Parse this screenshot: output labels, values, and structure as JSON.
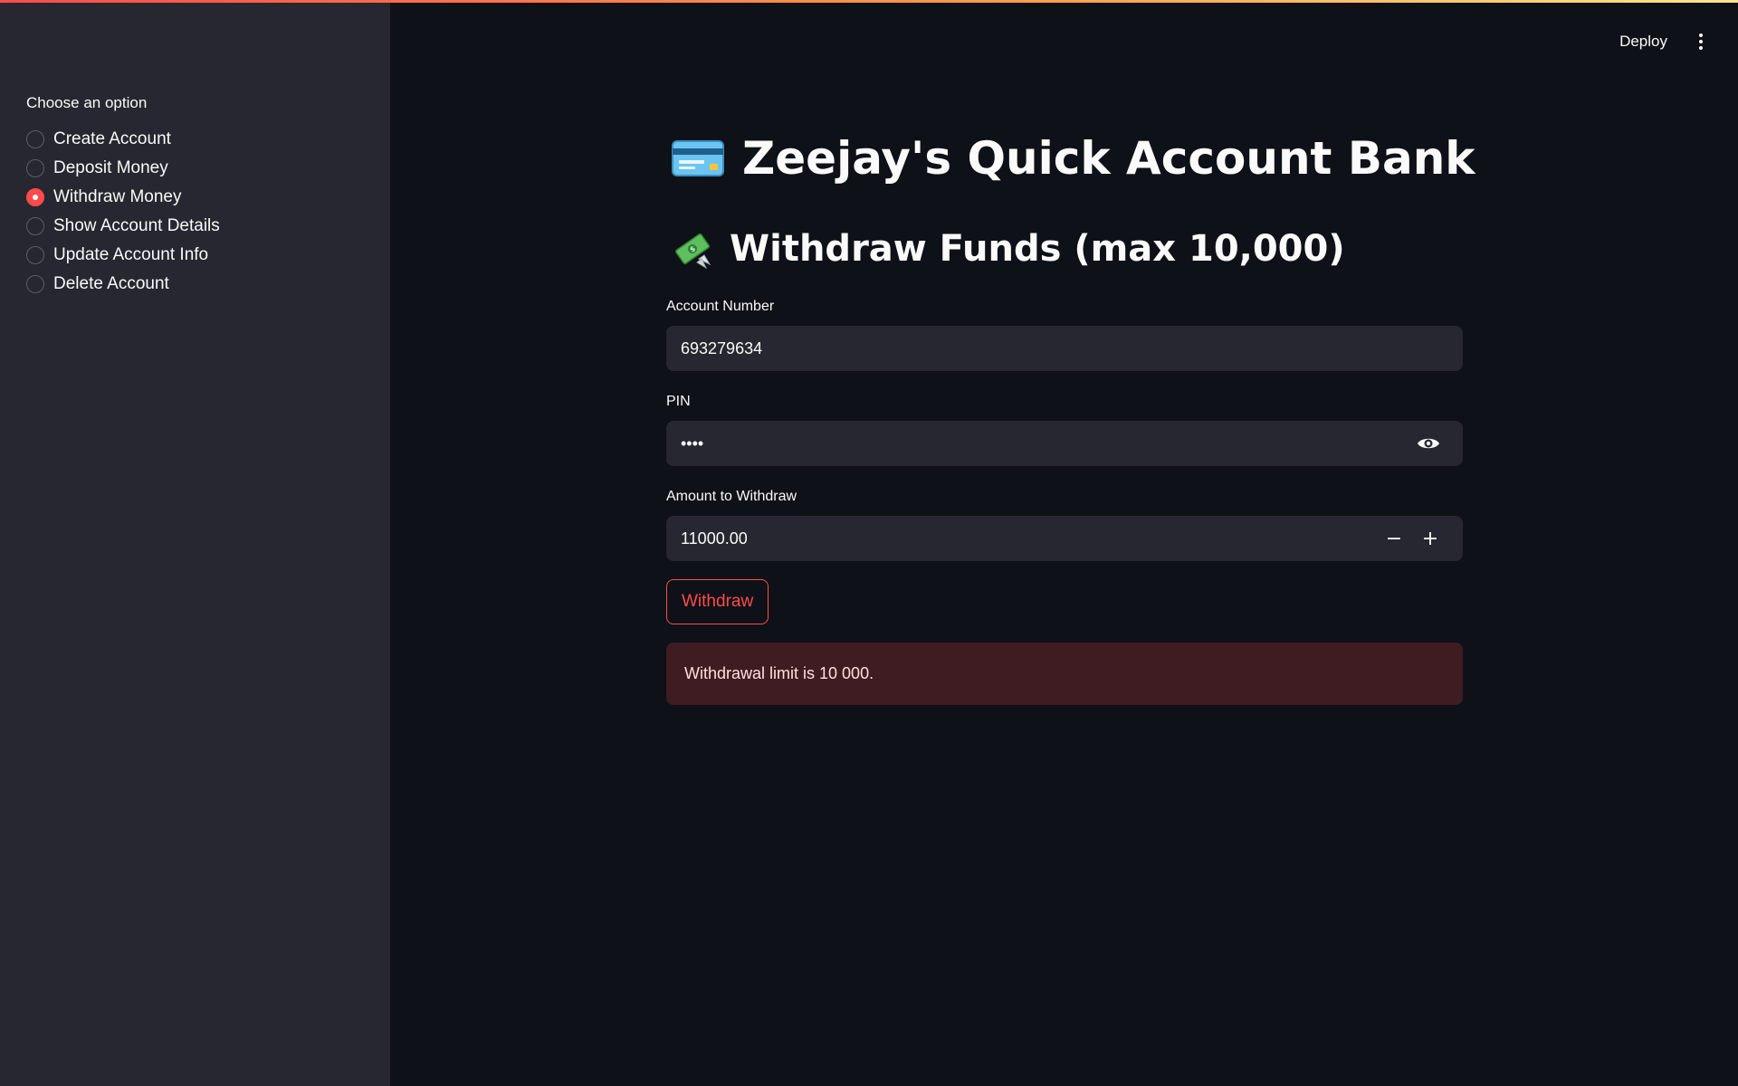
{
  "sidebar": {
    "heading": "Choose an option",
    "options": [
      {
        "label": "Create Account",
        "selected": false
      },
      {
        "label": "Deposit Money",
        "selected": false
      },
      {
        "label": "Withdraw Money",
        "selected": true
      },
      {
        "label": "Show Account Details",
        "selected": false
      },
      {
        "label": "Update Account Info",
        "selected": false
      },
      {
        "label": "Delete Account",
        "selected": false
      }
    ]
  },
  "header": {
    "deploy_label": "Deploy",
    "menu_icon": "kebab-menu-icon"
  },
  "main": {
    "title": "Zeejay's Quick Account Bank",
    "title_icon": "credit-card-icon",
    "subheader": "Withdraw Funds (max 10,000)",
    "subheader_icon": "money-with-wings-icon",
    "account_number": {
      "label": "Account Number",
      "value": "693279634"
    },
    "pin": {
      "label": "PIN",
      "value": "••••",
      "toggle_icon": "eye-icon"
    },
    "amount": {
      "label": "Amount to Withdraw",
      "value": "11000.00",
      "minus": "−",
      "plus": "+"
    },
    "withdraw_label": "Withdraw",
    "error_message": "Withdrawal limit is 10 000."
  },
  "colors": {
    "accent": "#ff4b4b",
    "background": "#0e1117",
    "sidebar": "#262730",
    "input": "#262730"
  }
}
